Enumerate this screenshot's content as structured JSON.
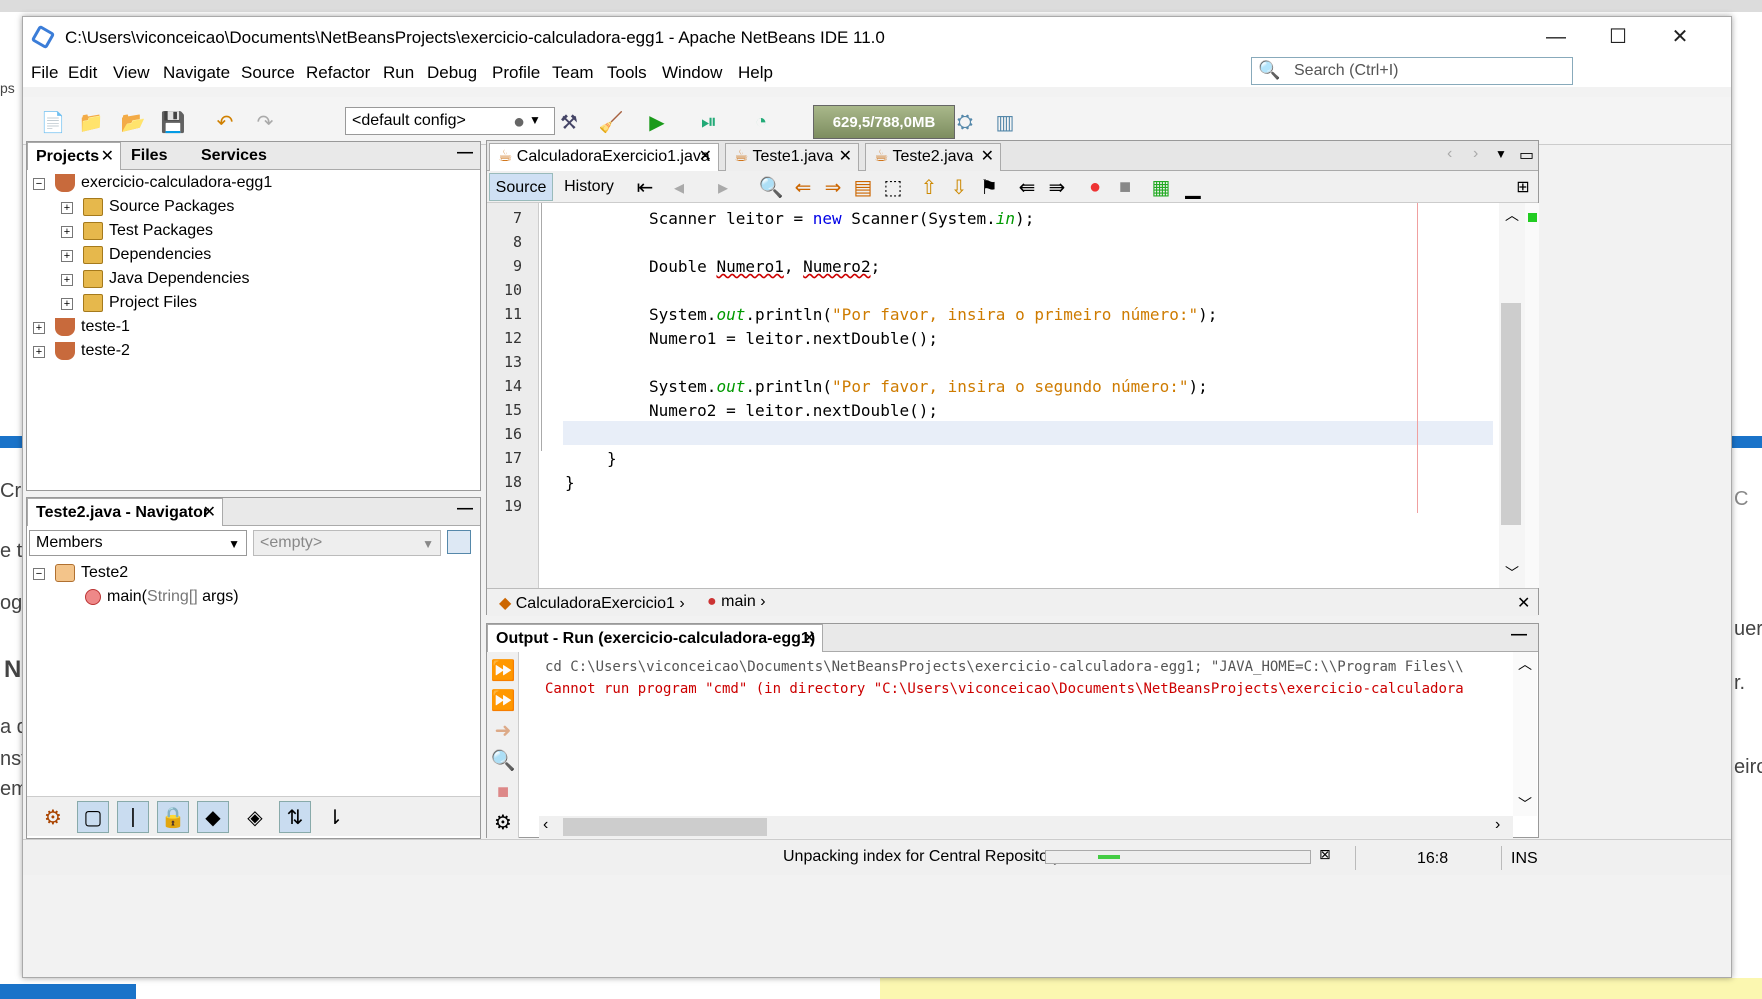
{
  "window": {
    "title": "C:\\Users\\viconceicao\\Documents\\NetBeansProjects\\exercicio-calculadora-egg1 - Apache NetBeans IDE 11.0",
    "minimize": "—",
    "maximize": "☐",
    "close": "✕"
  },
  "menu": [
    "File",
    "Edit",
    "View",
    "Navigate",
    "Source",
    "Refactor",
    "Run",
    "Debug",
    "Profile",
    "Team",
    "Tools",
    "Window",
    "Help"
  ],
  "search": {
    "placeholder": "Search (Ctrl+I)"
  },
  "toolbar": {
    "config": "<default config>",
    "memory": "629,5/788,0MB"
  },
  "projects": {
    "tabs": [
      "Projects",
      "Files",
      "Services"
    ],
    "root": "exercicio-calculadora-egg1",
    "children": [
      "Source Packages",
      "Test Packages",
      "Dependencies",
      "Java Dependencies",
      "Project Files"
    ],
    "others": [
      "teste-1",
      "teste-2"
    ]
  },
  "navigator": {
    "title": "Teste2.java - Navigator",
    "filter": "Members",
    "empty": "<empty>",
    "class": "Teste2",
    "method": "main(",
    "method_args": "String[]",
    "method_rest": " args)"
  },
  "editor": {
    "tabs": [
      "CalculadoraExercicio1.java",
      "Teste1.java",
      "Teste2.java"
    ],
    "views": [
      "Source",
      "History"
    ],
    "line_numbers": [
      "7",
      "8",
      "9",
      "10",
      "11",
      "12",
      "13",
      "14",
      "15",
      "16",
      "17",
      "18",
      "19"
    ],
    "code": {
      "l7a": "Scanner leitor = ",
      "l7b": "new",
      "l7c": " Scanner(System.",
      "l7d": "in",
      "l7e": ");",
      "l9a": "Double ",
      "l9b": "Numero1",
      "l9c": ", ",
      "l9d": "Numero2",
      "l9e": ";",
      "l11a": "System.",
      "l11b": "out",
      "l11c": ".println(",
      "l11d": "\"Por favor, insira o primeiro número:\"",
      "l11e": ");",
      "l12": "Numero1 = leitor.nextDouble();",
      "l14a": "System.",
      "l14b": "out",
      "l14c": ".println(",
      "l14d": "\"Por favor, insira o segundo número:\"",
      "l14e": ");",
      "l15": "Numero2 = leitor.nextDouble();",
      "l17": "}",
      "l18": "}"
    },
    "breadcrumb": [
      "CalculadoraExercicio1",
      "main"
    ]
  },
  "output": {
    "title": "Output - Run (exercicio-calculadora-egg1)",
    "line1": "cd C:\\Users\\viconceicao\\Documents\\NetBeansProjects\\exercicio-calculadora-egg1; \"JAVA_HOME=C:\\\\Program Files\\\\",
    "line2": "Cannot run program \"cmd\" (in directory \"C:\\Users\\viconceicao\\Documents\\NetBeansProjects\\exercicio-calculadora"
  },
  "status": {
    "message": "Unpacking index for Central Repository",
    "position": "16:8",
    "mode": "INS"
  },
  "background": {
    "left_texts": [
      "ps",
      "Cria",
      "e t",
      "og",
      "N",
      "a di",
      "nst",
      "em"
    ],
    "right_texts": [
      "C",
      "uer'",
      "r.",
      "eiro"
    ]
  },
  "colors": {
    "keyword": "#0000e6",
    "string": "#ce7b00",
    "field": "#009900",
    "error": "#cc0000"
  }
}
